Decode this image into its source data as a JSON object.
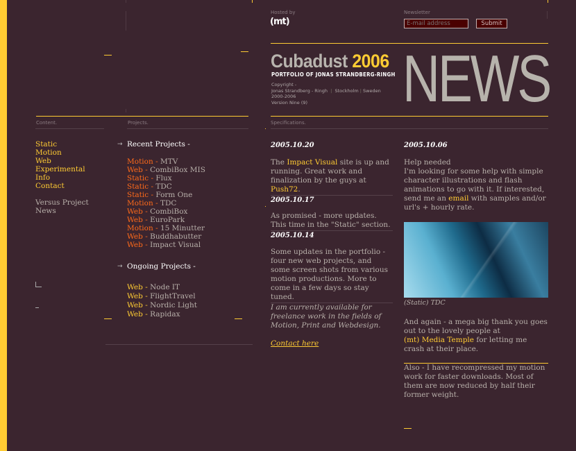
{
  "header": {
    "hosted_by_label": "Hosted by",
    "hosted_logo": "(mt)",
    "newsletter_label": "Newsletter",
    "email_placeholder": "E-mail address",
    "submit_label": "Submit",
    "site_name": "Cubadust",
    "site_year": "2006",
    "tagline": "PORTFOLIO OF JONAS STRANDBERG-RINGH",
    "copyright_lines": [
      "Copyright -",
      "Jonas Strandberg - Ringh",
      "Stockholm",
      "Sweden",
      "2000-2006",
      "Version Nine (9)"
    ],
    "page_title": "NEWS"
  },
  "sections": {
    "content": "Content.",
    "projects": "Projects.",
    "specifications": "Specifications."
  },
  "nav": {
    "primary": [
      "Static",
      "Motion",
      "Web",
      "Experimental",
      "Info",
      "Contact"
    ],
    "secondary": [
      "Versus Project",
      "News"
    ]
  },
  "projects": {
    "recent_title": "Recent Projects -",
    "recent": [
      {
        "cat": "Motion",
        "name": "MTV"
      },
      {
        "cat": "Web",
        "name": "CombiBox MIS"
      },
      {
        "cat": "Static",
        "name": "Flux"
      },
      {
        "cat": "Static",
        "name": "TDC"
      },
      {
        "cat": "Static",
        "name": "Form One"
      },
      {
        "cat": "Motion",
        "name": "TDC"
      },
      {
        "cat": "Web",
        "name": "CombiBox"
      },
      {
        "cat": "Web",
        "name": "EuroPark"
      },
      {
        "cat": "Motion",
        "name": "15 Minutter"
      },
      {
        "cat": "Web",
        "name": "Buddhabutter"
      },
      {
        "cat": "Web",
        "name": "Impact Visual"
      }
    ],
    "ongoing_title": "Ongoing Projects -",
    "ongoing": [
      {
        "cat": "Web",
        "name": "Node IT"
      },
      {
        "cat": "Web",
        "name": "FlightTravel"
      },
      {
        "cat": "Web",
        "name": "Nordic Light"
      },
      {
        "cat": "Web",
        "name": "Rapidax"
      }
    ],
    "separator": " - "
  },
  "news_left": {
    "entry1": {
      "date": "2005.10.20",
      "t1": "The ",
      "link1": "Impact Visual",
      "t2": " site is up and running. Great work and finalization by the guys at ",
      "link2": "Push72",
      "t3": "."
    },
    "entry2": {
      "date": "2005.10.17",
      "text": "As promised - more updates. This time in the \"Static\" section."
    },
    "entry3": {
      "date": "2005.10.14",
      "text": "Some updates in the portfolio - four new web projects, and some screen shots from various motion productions. More to come in a few days so stay tuned."
    },
    "availability": "I am currently available for freelance work in the fields of Motion, Print and Webdesign.",
    "contact_link": "Contact here"
  },
  "news_right": {
    "date": "2005.10.06",
    "help_title": "Help needed",
    "help_t1": "I'm looking for some help with simple character illustrations and flash animations to go with it. If interested, send me an ",
    "help_link": "email",
    "help_t2": " with samples and/or url's + hourly rate.",
    "image_caption": "(Static) TDC",
    "thanks_t1": "And again - a mega big thank you goes out to the lovely people at",
    "thanks_link": "(mt) Media Temple",
    "thanks_t2": " for letting me crash at their place.",
    "also_text": "Also - I have recompressed my motion work for faster downloads. Most of them are now reduced by half their former weight."
  },
  "colors": {
    "background": "#3b252f",
    "accent": "#ffcc33",
    "category": "#ff6a1a",
    "text": "#b8b0aa"
  }
}
